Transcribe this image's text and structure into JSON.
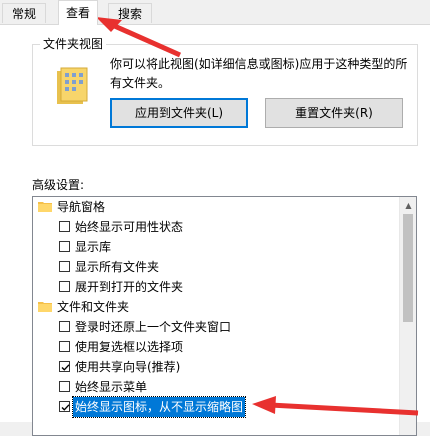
{
  "tabs": [
    {
      "label": "常规"
    },
    {
      "label": "查看"
    },
    {
      "label": "搜索"
    }
  ],
  "folder_view": {
    "title": "文件夹视图",
    "description": "你可以将此视图(如详细信息或图标)应用于这种类型的所有文件夹。",
    "apply_button": "应用到文件夹(L)",
    "reset_button": "重置文件夹(R)"
  },
  "advanced": {
    "label": "高级设置:",
    "items": [
      {
        "type": "folder",
        "label": "导航窗格"
      },
      {
        "type": "check",
        "label": "始终显示可用性状态",
        "checked": false
      },
      {
        "type": "check",
        "label": "显示库",
        "checked": false
      },
      {
        "type": "check",
        "label": "显示所有文件夹",
        "checked": false
      },
      {
        "type": "check",
        "label": "展开到打开的文件夹",
        "checked": false
      },
      {
        "type": "folder",
        "label": "文件和文件夹"
      },
      {
        "type": "check",
        "label": "登录时还原上一个文件夹窗口",
        "checked": false
      },
      {
        "type": "check",
        "label": "使用复选框以选择项",
        "checked": false
      },
      {
        "type": "check",
        "label": "使用共享向导(推荐)",
        "checked": true
      },
      {
        "type": "check",
        "label": "始终显示菜单",
        "checked": false
      },
      {
        "type": "check",
        "label": "始终显示图标，从不显示缩略图",
        "checked": true,
        "selected": true
      }
    ]
  },
  "colors": {
    "accent": "#0078d7",
    "annotation": "#e8312f"
  }
}
